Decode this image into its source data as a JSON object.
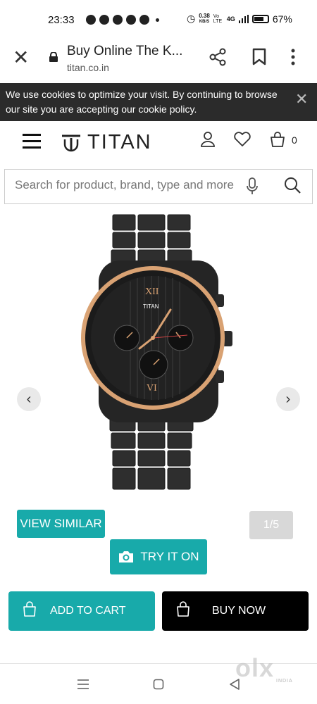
{
  "status_bar": {
    "time": "23:33",
    "network_speed": "0.38",
    "network_unit": "KB/S",
    "signal_label": "Vo LTE",
    "network_type": "4G",
    "battery": "67%"
  },
  "browser": {
    "title": "Buy Online The K...",
    "url": "titan.co.in",
    "icons": [
      "close-icon",
      "lock-icon",
      "share-icon",
      "bookmark-icon",
      "more-vert-icon"
    ]
  },
  "cookie_banner": {
    "text": "We use cookies to optimize your visit. By continuing to browse our site you are accepting our cookie policy."
  },
  "header": {
    "brand": "TITAN",
    "cart_count": "0",
    "icons": [
      "menu-icon",
      "titan-logo",
      "account-icon",
      "wishlist-icon",
      "cart-icon"
    ]
  },
  "search": {
    "placeholder": "Search for product, brand, type and more"
  },
  "product": {
    "image_alt": "Black chronograph watch with rose gold bezel",
    "watch_dial_brand": "TITAN",
    "image_counter": "1/5"
  },
  "actions": {
    "view_similar": "VIEW SIMILAR",
    "try_it_on": "TRY IT ON",
    "add_to_cart": "ADD TO CART",
    "buy_now": "BUY NOW"
  },
  "watermark": {
    "text": "olx",
    "sub": "INDIA"
  },
  "colors": {
    "accent": "#18aaaa",
    "buy_now_bg": "#000000",
    "cookie_bg": "#2b2b2b",
    "bezel": "#d9a273"
  }
}
